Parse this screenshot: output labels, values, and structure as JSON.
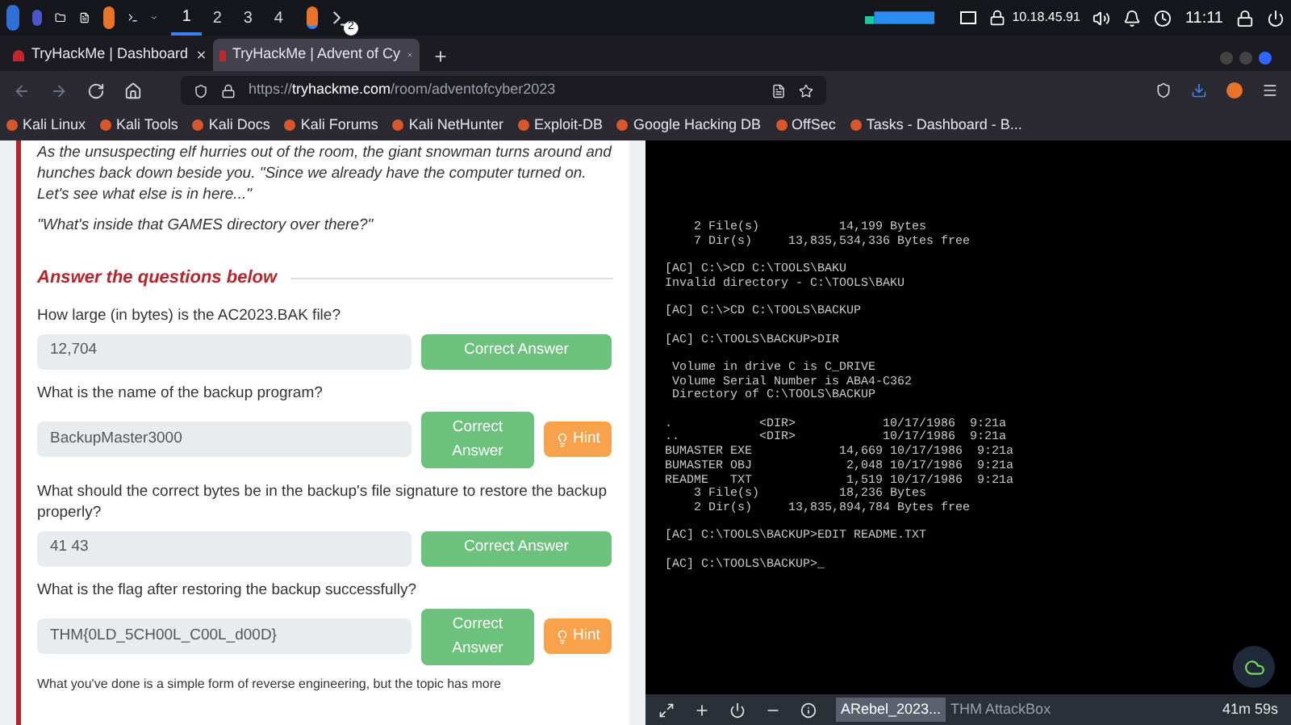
{
  "taskbar": {
    "workspaces": [
      {
        "label": "1",
        "selected": true
      },
      {
        "label": "2",
        "selected": false
      },
      {
        "label": "3",
        "selected": false
      },
      {
        "label": "4",
        "selected": false
      }
    ],
    "badge": "2",
    "ip": "10.18.45.91",
    "time": "11:11"
  },
  "tabs": [
    {
      "label": "TryHackMe | Dashboard",
      "selected": false
    },
    {
      "label": "TryHackMe | Advent of Cy",
      "selected": true
    }
  ],
  "url": {
    "prefix": "https://",
    "domain": "tryhackme.com",
    "path": "/room/adventofcyber2023"
  },
  "bookmarks": [
    "Kali Linux",
    "Kali Tools",
    "Kali Docs",
    "Kali Forums",
    "Kali NetHunter",
    "Exploit-DB",
    "Google Hacking DB",
    "OffSec",
    "Tasks - Dashboard - B..."
  ],
  "story": [
    "As the unsuspecting elf hurries out of the room, the giant snowman turns around and hunches back down beside you. \"Since we already have the computer turned on. Let's see what else is in here...\"",
    "\"What's inside that GAMES directory over there?\""
  ],
  "questions_heading": "Answer the questions below",
  "questions": [
    {
      "question": "How large (in bytes) is the AC2023.BAK file?",
      "answer": "12,704",
      "button": "Correct Answer"
    },
    {
      "question": "What is the name of the backup program?",
      "answer": "BackupMaster3000",
      "button": "Correct Answer",
      "hint": "Hint"
    },
    {
      "question": "What should the correct bytes be in the backup's file signature to restore the backup properly?",
      "answer": "41 43",
      "button": "Correct Answer"
    },
    {
      "question": "What is the flag after restoring the backup successfully?",
      "answer": "THM{0LD_5CH00L_C00L_d00D}",
      "button": "Correct Answer",
      "hint": "Hint"
    }
  ],
  "footer_text": "What you've done is a simple form of reverse engineering, but the topic has more",
  "terminal": [
    [
      "    2 File(s)           14,199 Bytes",
      "    7 Dir(s)     13,835,534,336 Bytes free"
    ],
    [
      "[AC] C:\\>CD C:\\TOOLS\\BAKU",
      "Invalid directory - C:\\TOOLS\\BAKU"
    ],
    [
      "[AC] C:\\>CD C:\\TOOLS\\BACKUP"
    ],
    [
      "[AC] C:\\TOOLS\\BACKUP>DIR"
    ],
    [
      " Volume in drive C is C_DRIVE",
      " Volume Serial Number is ABA4-C362",
      " Directory of C:\\TOOLS\\BACKUP"
    ],
    [
      ".            <DIR>            10/17/1986  9:21a",
      "..           <DIR>            10/17/1986  9:21a",
      "BUMASTER EXE            14,669 10/17/1986  9:21a",
      "BUMASTER OBJ             2,048 10/17/1986  9:21a",
      "README   TXT             1,519 10/17/1986  9:21a",
      "    3 File(s)           18,236 Bytes",
      "    2 Dir(s)     13,835,894,784 Bytes free"
    ],
    [
      "[AC] C:\\TOOLS\\BACKUP>EDIT README.TXT"
    ],
    [
      "[AC] C:\\TOOLS\\BACKUP>_"
    ]
  ],
  "bottom_bar": {
    "tabs": [
      {
        "label": "ARebel_2023...",
        "selected": true
      },
      {
        "label": "THM AttackBox",
        "selected": false
      }
    ],
    "timer": "41m 59s"
  }
}
